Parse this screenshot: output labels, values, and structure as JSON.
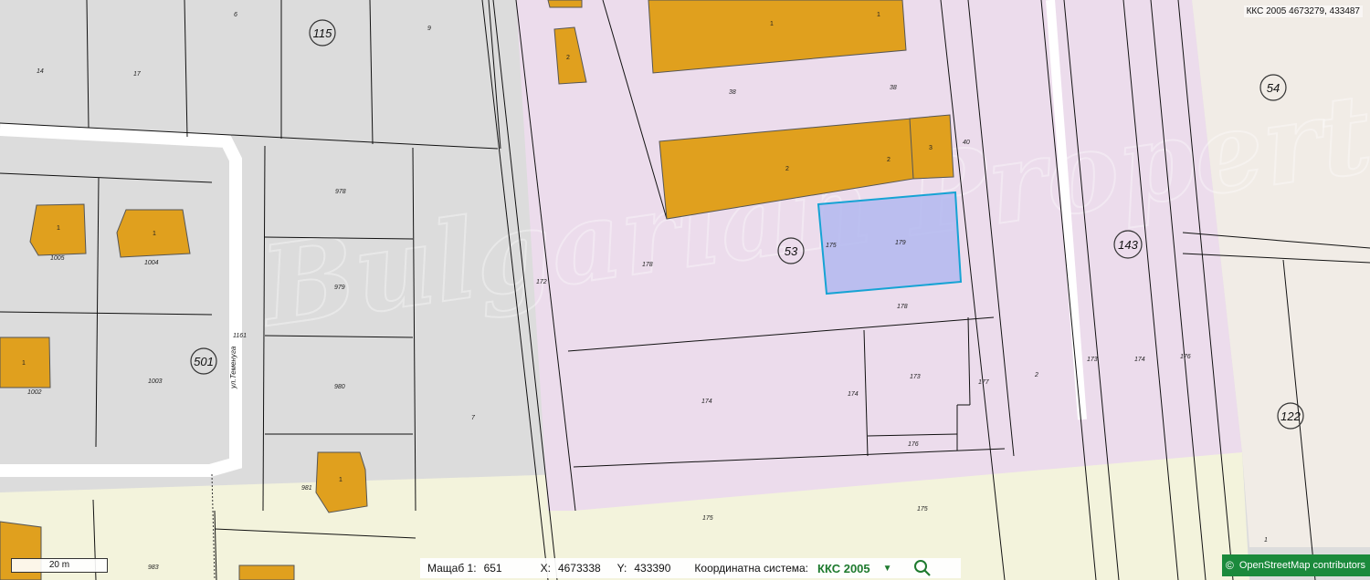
{
  "map": {
    "coord_readout": "ККС 2005 4673279, 433487",
    "scale_label": "20 m",
    "quarters": [
      "115",
      "54",
      "53",
      "143",
      "501",
      "122"
    ],
    "street": "ул.Теменуга",
    "plots": {
      "p14": "14",
      "p17": "17",
      "p6": "6",
      "p9": "9",
      "p978": "978",
      "p979": "979",
      "p980": "980",
      "p981": "981",
      "p983": "983",
      "p1005": "1005",
      "p1004": "1004",
      "p1003": "1003",
      "p1002": "1002",
      "p1161": "1161",
      "p7": "7",
      "p172": "172",
      "p38a": "38",
      "p38b": "38",
      "p40": "40",
      "p178a": "178",
      "p178b": "178",
      "p179": "179",
      "p175a": "175",
      "p174a": "174",
      "p174b": "174",
      "p173a": "173",
      "p177": "177",
      "p176a": "176",
      "p175b": "175",
      "p175c": "175",
      "p2": "2",
      "p173b": "173",
      "p174c": "174",
      "p176b": "176",
      "p1": "1"
    },
    "buildings": {
      "b1a": "1",
      "b1b": "1",
      "b2": "2",
      "b2a": "2",
      "b2b": "2",
      "b3": "3",
      "b1004": "1",
      "b1005": "1",
      "b1002": "1",
      "b981": "1"
    },
    "colors": {
      "grey_zone": "#dcdcdc",
      "pink_zone": "#ecdcec",
      "yellow_zone": "#f3f3dc",
      "beige_zone": "#f1ece6",
      "building": "#e0a01e",
      "highlight": "#b3b9f0",
      "highlight_border": "#16a3d4",
      "osm_green": "#1b8a3c"
    }
  },
  "status": {
    "scale_label": "Мащаб 1:",
    "scale_value": "651",
    "x_label": "X:",
    "x_value": "4673338",
    "y_label": "Y:",
    "y_value": "433390",
    "system_label": "Координатна система:",
    "system_value": "ККС 2005",
    "dropdown_icon": "triangle-down-icon",
    "search_icon": "magnifier-icon"
  },
  "attribution": {
    "copyright_symbol": "©",
    "text": "OpenStreetMap  contributors"
  }
}
